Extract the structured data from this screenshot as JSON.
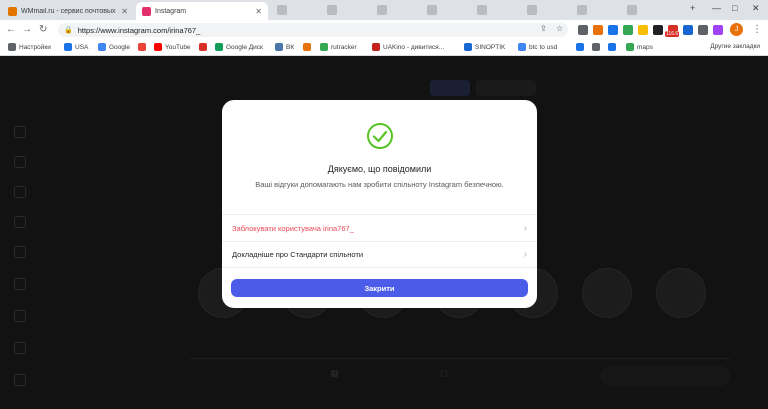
{
  "tabs": [
    {
      "title": "WMmail.ru - сервис почтовых ра",
      "color": "#e37400"
    },
    {
      "title": "Instagram",
      "color": "#e1306c"
    }
  ],
  "toolbar": {
    "url": "https://www.instagram.com/irina767_",
    "badge": "116.6"
  },
  "bookmarks": [
    {
      "label": "Настройки",
      "color": "#5f6368"
    },
    {
      "label": "USA",
      "color": "#1a73e8"
    },
    {
      "label": "Google",
      "color": "#4285f4"
    },
    {
      "label": "",
      "color": "#ea4335"
    },
    {
      "label": "YouTube",
      "color": "#ff0000"
    },
    {
      "label": "",
      "color": "#d93025"
    },
    {
      "label": "Google Диск",
      "color": "#0f9d58"
    },
    {
      "label": "ВК",
      "color": "#4a76a8"
    },
    {
      "label": "",
      "color": "#e8710a"
    },
    {
      "label": "rutracker",
      "color": "#34a853"
    },
    {
      "label": "UAKino - дивитися...",
      "color": "#c5221f"
    },
    {
      "label": "SINOPTIK",
      "color": "#1967d2"
    },
    {
      "label": "btc to usd",
      "color": "#4285f4"
    },
    {
      "label": "",
      "color": "#1a73e8"
    },
    {
      "label": "",
      "color": "#5f6368"
    },
    {
      "label": "",
      "color": "#1a73e8"
    },
    {
      "label": "maps",
      "color": "#34a853"
    }
  ],
  "other_bookmarks": "Другие закладки",
  "modal": {
    "title": "Дякуємо, що повідомили",
    "subtitle": "Ваші відгуки допомагають нам зробити спільноту Instagram безпечною.",
    "block_user": "Заблокувати користувача irina767_",
    "learn_more": "Докладніше про Стандарти спільноти",
    "close": "Закрити"
  },
  "colors": {
    "accent": "#4a5ce8",
    "danger": "#ed4956",
    "success": "#58c322"
  }
}
